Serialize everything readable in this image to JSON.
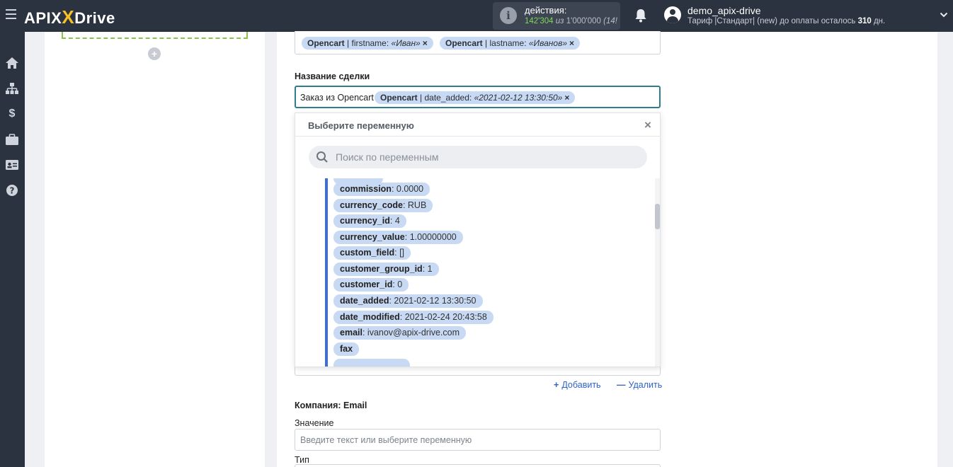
{
  "header": {
    "logo_left": "APIX",
    "logo_x": "X",
    "logo_right": "Drive",
    "actions_label": "действия:",
    "actions_used": "142'304",
    "actions_of": "из",
    "actions_total": "1'000'000",
    "actions_extra": "(14!",
    "username": "demo_apix-drive",
    "plan_prefix": "Тариф |Стандарт| (new) до оплаты осталось",
    "plan_days": "310",
    "plan_suffix": "дн."
  },
  "sidebar": {
    "icons": [
      "home-icon",
      "sitemap-icon",
      "dollar-icon",
      "briefcase-icon",
      "id-card-icon",
      "help-icon"
    ]
  },
  "contact_field": {
    "tags": [
      {
        "source": "Opencart",
        "field": "firstname",
        "value": "«Иван»"
      },
      {
        "source": "Opencart",
        "field": "lastname",
        "value": "«Иванов»"
      }
    ]
  },
  "deal_name": {
    "label": "Название сделки",
    "static_text": "Заказ из Opencart",
    "tag": {
      "source": "Opencart",
      "field": "date_added",
      "value": "«2021-02-12 13:30:50»"
    }
  },
  "dropdown": {
    "title": "Выберите переменную",
    "close": "×",
    "search_placeholder": "Поиск по переменным",
    "items": [
      {
        "key": "commission",
        "value": "0.0000"
      },
      {
        "key": "currency_code",
        "value": "RUB"
      },
      {
        "key": "currency_id",
        "value": "4"
      },
      {
        "key": "currency_value",
        "value": "1.00000000"
      },
      {
        "key": "custom_field",
        "value": "[]"
      },
      {
        "key": "customer_group_id",
        "value": "1"
      },
      {
        "key": "customer_id",
        "value": "0"
      },
      {
        "key": "date_added",
        "value": "2021-02-12 13:30:50"
      },
      {
        "key": "date_modified",
        "value": "2021-02-24 20:43:58"
      },
      {
        "key": "email",
        "value": "ivanov@apix-drive.com"
      },
      {
        "key": "fax",
        "value": ""
      }
    ]
  },
  "actions": {
    "add": "Добавить",
    "remove": "Удалить"
  },
  "company_email": {
    "label": "Компания: Email",
    "value_label": "Значение",
    "value_placeholder": "Введите текст или выберите переменную",
    "type_label": "Тип"
  },
  "colors": {
    "topbar": "#2c3340",
    "tag": "#c8daf3",
    "accent": "#3e6fd8",
    "active_border": "#2e7d8c"
  }
}
